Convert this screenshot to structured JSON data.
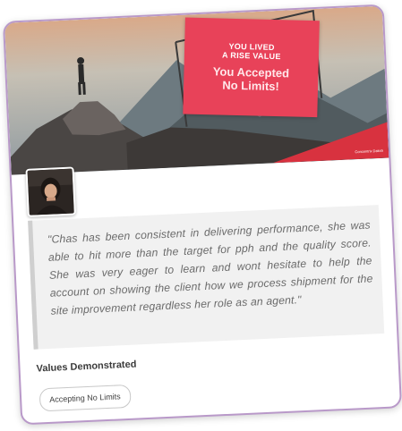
{
  "banner": {
    "sign_line1": "YOU LIVED",
    "sign_line2": "A RISE VALUE",
    "sign_line3": "You Accepted",
    "sign_line4": "No Limits!",
    "accent_color": "#e84259",
    "corner_logo_text": "Concentrix Daksh"
  },
  "recognition": {
    "quote": "\"Chas has been consistent in delivering performance, she was able to hit more than the target for pph and the quality score. She was very eager to learn and wont hesitate to help the account on showing the client how we process shipment for the site improvement regardless her role as an agent.\""
  },
  "values_section": {
    "title": "Values Demonstrated",
    "chips": [
      "Accepting No Limits"
    ]
  },
  "card_border_color": "#b999c9"
}
